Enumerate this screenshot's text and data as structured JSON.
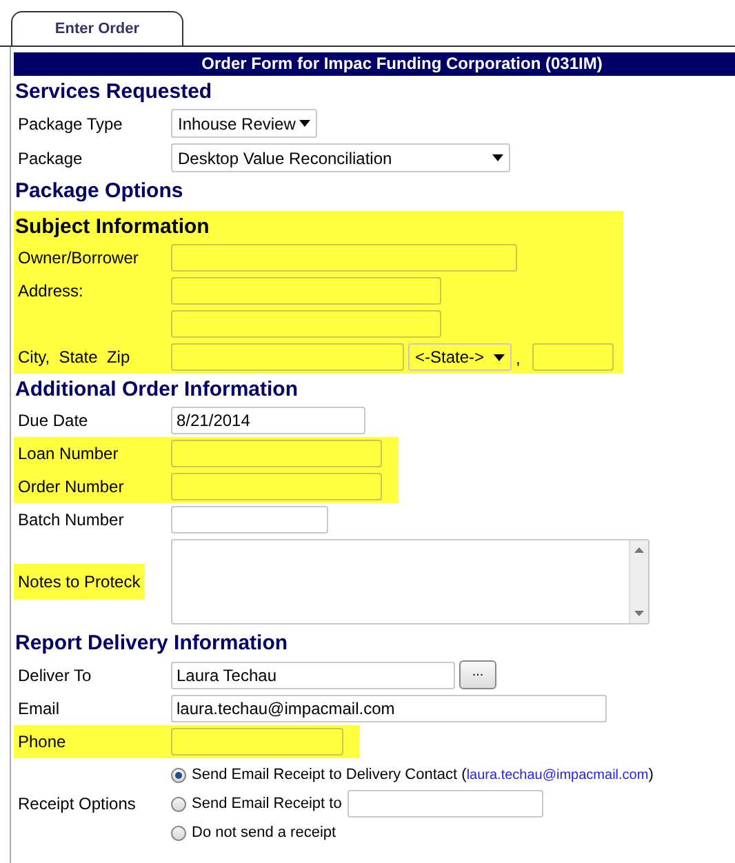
{
  "tab": {
    "label": "Enter Order",
    "selected": true
  },
  "banner": "Order Form for Impac Funding Corporation (031IM)",
  "sections": [
    {
      "title": "Services Requested",
      "highlighted": false,
      "rows": [
        {
          "kind": "select",
          "label": "Package Type",
          "value": "Inhouse Review",
          "highlighted": false
        },
        {
          "kind": "select",
          "label": "Package",
          "value": "Desktop Value Reconciliation",
          "highlighted": false
        }
      ]
    },
    {
      "title": "Package Options",
      "highlighted": false
    },
    {
      "title": "Subject Information",
      "highlighted": true,
      "rows": [
        {
          "kind": "text",
          "label": "Owner/Borrower",
          "highlighted": false
        },
        {
          "kind": "address",
          "label": "Address:",
          "highlighted": false
        },
        {
          "kind": "citystatezip",
          "label": "City,  State  Zip",
          "state": "<-State->",
          "separator": ",",
          "highlighted": false
        }
      ]
    },
    {
      "title": "Additional Order Information",
      "highlighted": false,
      "rows": [
        {
          "kind": "text",
          "label": "Due Date",
          "value": "8/21/2014",
          "highlighted": false
        },
        {
          "kind": "text",
          "label": "Loan Number",
          "highlighted": true
        },
        {
          "kind": "text",
          "label": "Order Number",
          "highlighted": true
        },
        {
          "kind": "text",
          "label": "Batch Number",
          "highlighted": false
        },
        {
          "kind": "textarea",
          "label": "Notes to Proteck",
          "highlighted": true
        }
      ]
    },
    {
      "title": "Report Delivery Information",
      "highlighted": false,
      "rows": [
        {
          "kind": "lookup",
          "label": "Deliver To",
          "value": "Laura Techau",
          "button": "...",
          "highlighted": false
        },
        {
          "kind": "text",
          "label": "Email",
          "value": "laura.techau@impacmail.com",
          "highlighted": false
        },
        {
          "kind": "text",
          "label": "Phone",
          "highlighted": true
        },
        {
          "kind": "radios",
          "label": "Receipt Options",
          "highlighted": false,
          "options": [
            {
              "kind": "link",
              "label": "Send Email Receipt to Delivery Contact (",
              "link": "laura.techau@impacmail.com",
              "suffix": ")",
              "selected": true
            },
            {
              "kind": "input",
              "label": "Send Email Receipt to",
              "selected": false
            },
            {
              "kind": "plain",
              "label": "Do not send a receipt",
              "selected": false
            }
          ]
        }
      ]
    }
  ]
}
